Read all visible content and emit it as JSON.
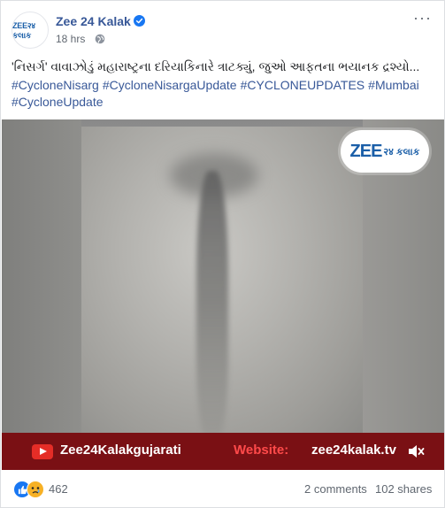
{
  "post": {
    "page_name": "Zee 24 Kalak",
    "avatar_text": "ZEE२४ કલાક",
    "timestamp": "18 hrs",
    "more_label": "···",
    "caption": "'નિસર્ગ' વાવાઝોડું મહારાષ્ટ્રના દરિયાકિનારે ત્રાટક્યું, જુઓ આફતના ભયાનક દ્રશ્યો...",
    "hashtags": [
      "#CycloneNisarg",
      "#CycloneNisargaUpdate",
      "#CYCLONEUPDATES",
      "#Mumbai",
      "#CycloneUpdate"
    ]
  },
  "video": {
    "watermark_zee": "ZEE",
    "watermark_sub": "२४ કલાક",
    "banner": {
      "youtube_handle": "Zee24Kalakgujarati",
      "website_label": "Website:",
      "website_url": "zee24kalak.tv"
    }
  },
  "footer": {
    "reaction_count": "462",
    "reactions": [
      "like-icon",
      "sad-icon"
    ],
    "comments": "2 comments",
    "shares": "102 shares"
  },
  "colors": {
    "link": "#385898",
    "banner_bg": "#7a1014",
    "website_label": "#ff4a4a",
    "like": "#1877f2"
  }
}
